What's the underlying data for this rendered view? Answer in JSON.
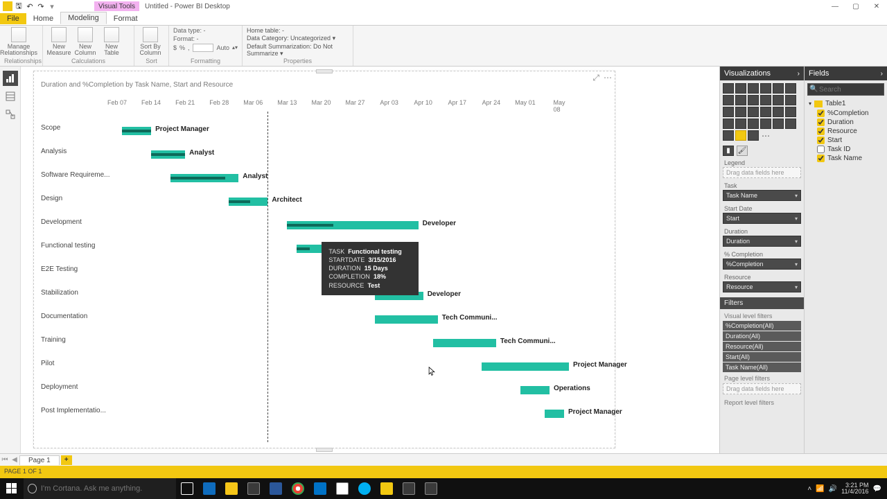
{
  "window": {
    "title": "Untitled - Power BI Desktop",
    "visual_tools": "Visual Tools"
  },
  "tabs": {
    "file": "File",
    "home": "Home",
    "modeling": "Modeling",
    "format": "Format"
  },
  "ribbon": {
    "relationships": {
      "btn": "Manage\nRelationships",
      "group": "Relationships"
    },
    "calculations": {
      "new_measure": "New\nMeasure",
      "new_column": "New\nColumn",
      "new_table": "New\nTable",
      "group": "Calculations"
    },
    "sort": {
      "btn": "Sort By\nColumn",
      "group": "Sort"
    },
    "formatting": {
      "data_type": "Data type: -",
      "format": "Format: -",
      "auto": "Auto",
      "group": "Formatting"
    },
    "properties": {
      "home_table": "Home table: -",
      "data_cat": "Data Category: Uncategorized ▾",
      "def_sum": "Default Summarization: Do Not Summarize ▾",
      "group": "Properties"
    }
  },
  "visual": {
    "title": "Duration and %Completion by Task Name, Start and Resource",
    "axis": [
      "Feb 07",
      "Feb 14",
      "Feb 21",
      "Feb 28",
      "Mar 06",
      "Mar 13",
      "Mar 20",
      "Mar 27",
      "Apr 03",
      "Apr 10",
      "Apr 17",
      "Apr 24",
      "May 01",
      "May 08"
    ]
  },
  "chart_data": {
    "type": "gantt",
    "title": "Duration and %Completion by Task Name, Start and Resource",
    "x_axis_dates": [
      "2016-02-07",
      "2016-02-14",
      "2016-02-21",
      "2016-02-28",
      "2016-03-06",
      "2016-03-13",
      "2016-03-20",
      "2016-03-27",
      "2016-04-03",
      "2016-04-10",
      "2016-04-17",
      "2016-04-24",
      "2016-05-01",
      "2016-05-08"
    ],
    "today_marker": "2016-03-09",
    "tasks": [
      {
        "task": "Scope",
        "resource": "Project Manager",
        "start": "2016-02-08",
        "duration_days": 6,
        "completion": 100
      },
      {
        "task": "Analysis",
        "resource": "Analyst",
        "start": "2016-02-14",
        "duration_days": 7,
        "completion": 100
      },
      {
        "task": "Software Requireme...",
        "resource": "Analyst",
        "start": "2016-02-18",
        "duration_days": 14,
        "completion": 80
      },
      {
        "task": "Design",
        "resource": "Architect",
        "start": "2016-03-01",
        "duration_days": 8,
        "completion": 55
      },
      {
        "task": "Development",
        "resource": "Developer",
        "start": "2016-03-13",
        "duration_days": 27,
        "completion": 35
      },
      {
        "task": "Functional testing",
        "resource": "Test",
        "start": "2016-03-15",
        "duration_days": 15,
        "completion": 18
      },
      {
        "task": "E2E Testing",
        "resource": "",
        "start": "2016-03-29",
        "duration_days": 0,
        "completion": 0
      },
      {
        "task": "Stabilization",
        "resource": "Developer",
        "start": "2016-03-31",
        "duration_days": 10,
        "completion": 0
      },
      {
        "task": "Documentation",
        "resource": "Tech Communi...",
        "start": "2016-03-31",
        "duration_days": 13,
        "completion": 0
      },
      {
        "task": "Training",
        "resource": "Tech Communi...",
        "start": "2016-04-12",
        "duration_days": 13,
        "completion": 0
      },
      {
        "task": "Pilot",
        "resource": "Project Manager",
        "start": "2016-04-22",
        "duration_days": 18,
        "completion": 0
      },
      {
        "task": "Deployment",
        "resource": "Operations",
        "start": "2016-04-30",
        "duration_days": 6,
        "completion": 0
      },
      {
        "task": "Post Implementatio...",
        "resource": "Project Manager",
        "start": "2016-05-05",
        "duration_days": 4,
        "completion": 0
      }
    ]
  },
  "tooltip": {
    "k_task": "TASK",
    "v_task": "Functional testing",
    "k_start": "STARTDATE",
    "v_start": "3/15/2016",
    "k_dur": "DURATION",
    "v_dur": "15 Days",
    "k_comp": "COMPLETION",
    "v_comp": "18%",
    "k_res": "RESOURCE",
    "v_res": "Test"
  },
  "viz_panel": {
    "header": "Visualizations",
    "legend_label": "Legend",
    "legend_hint": "Drag data fields here",
    "task_label": "Task",
    "task_value": "Task Name",
    "start_label": "Start Date",
    "start_value": "Start",
    "duration_label": "Duration",
    "duration_value": "Duration",
    "completion_label": "% Completion",
    "completion_value": "%Completion",
    "resource_label": "Resource",
    "resource_value": "Resource",
    "filters_header": "Filters",
    "vlf": "Visual level filters",
    "filters": [
      "%Completion(All)",
      "Duration(All)",
      "Resource(All)",
      "Start(All)",
      "Task Name(All)"
    ],
    "plf": "Page level filters",
    "plf_hint": "Drag data fields here",
    "rlf": "Report level filters"
  },
  "fields_panel": {
    "header": "Fields",
    "search_placeholder": "Search",
    "table": "Table1",
    "fields": [
      {
        "name": "%Completion",
        "checked": true
      },
      {
        "name": "Duration",
        "checked": true
      },
      {
        "name": "Resource",
        "checked": true
      },
      {
        "name": "Start",
        "checked": true
      },
      {
        "name": "Task ID",
        "checked": false
      },
      {
        "name": "Task Name",
        "checked": true
      }
    ]
  },
  "pagetabs": {
    "page": "Page 1"
  },
  "status": "PAGE 1 OF 1",
  "taskbar": {
    "cortana": "I'm Cortana. Ask me anything.",
    "time": "3:21 PM",
    "date": "11/4/2016"
  },
  "colors": {
    "accent": "#22bfa3",
    "accent_dark": "#0d6a5a",
    "pbi_yellow": "#f2c811"
  }
}
